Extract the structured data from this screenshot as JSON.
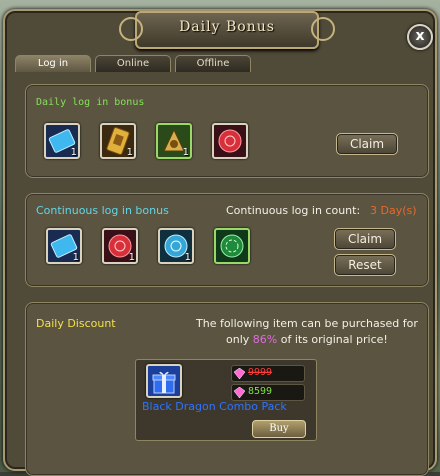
{
  "title": "Daily Bonus",
  "close_label": "x",
  "tabs": [
    {
      "label": "Log in",
      "active": true
    },
    {
      "label": "Online",
      "active": false
    },
    {
      "label": "Offline",
      "active": false
    }
  ],
  "daily": {
    "title": "Daily log in bonus",
    "items": [
      {
        "icon": "blue-ticket-icon",
        "qty": "1"
      },
      {
        "icon": "gold-card-icon",
        "qty": "1"
      },
      {
        "icon": "gold-amulet-icon",
        "qty": "1"
      },
      {
        "icon": "red-orb-icon",
        "qty": "1"
      }
    ],
    "claim_label": "Claim"
  },
  "continuous": {
    "title": "Continuous log in bonus",
    "count_label": "Continuous log in count:",
    "count_value": "3 Day(s)",
    "items": [
      {
        "icon": "blue-ticket-icon",
        "qty": "1"
      },
      {
        "icon": "red-orb-icon",
        "qty": "1"
      },
      {
        "icon": "blue-orb-icon",
        "qty": "1"
      },
      {
        "icon": "green-rune-icon",
        "qty": "1"
      }
    ],
    "claim_label": "Claim",
    "reset_label": "Reset"
  },
  "discount": {
    "title": "Daily Discount",
    "desc_line1": "The following item can be purchased for",
    "desc_line2_prefix": "only",
    "desc_percent": "86%",
    "desc_line2_suffix": "of its original price!",
    "item_name": "Black Dragon Combo Pack",
    "item_icon": "gift-box-icon",
    "old_price": "9999",
    "new_price": "8599",
    "buy_label": "Buy"
  },
  "colors": {
    "title_green": "#86e05a",
    "cyan": "#63d5e6",
    "orange": "#e56a2e",
    "yellow": "#f3e14a",
    "pink": "#e06be0",
    "blue_link": "#2f73ff"
  }
}
